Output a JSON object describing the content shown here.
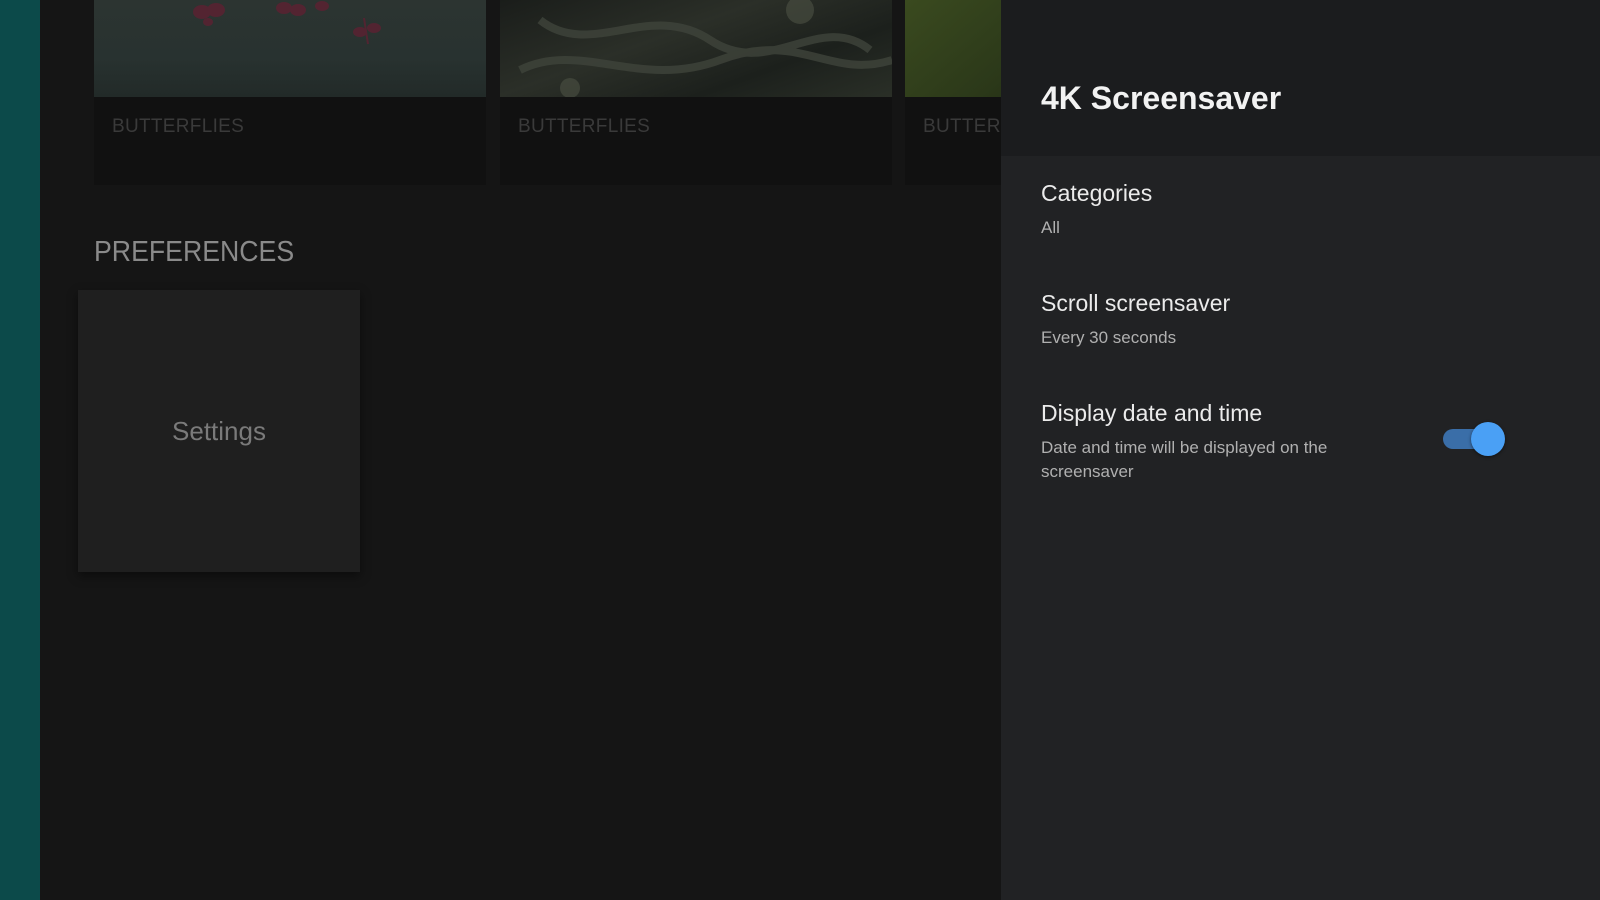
{
  "browse": {
    "cards": [
      {
        "caption": "BUTTERFLIES"
      },
      {
        "caption": "BUTTERFLIES"
      },
      {
        "caption": "BUTTERFLIES"
      }
    ],
    "section_title": "PREFERENCES",
    "settings_tile_label": "Settings"
  },
  "panel": {
    "title": "4K Screensaver",
    "items": [
      {
        "title": "Categories",
        "summary": "All"
      },
      {
        "title": "Scroll screensaver",
        "summary": "Every 30 seconds"
      },
      {
        "title": "Display date and time",
        "summary": "Date and time will be displayed on the screensaver",
        "toggle_on": true
      }
    ]
  },
  "colors": {
    "accent_strip": "#0c4a4a",
    "toggle_on": "#4aa0f5",
    "panel_bg": "#212224"
  }
}
